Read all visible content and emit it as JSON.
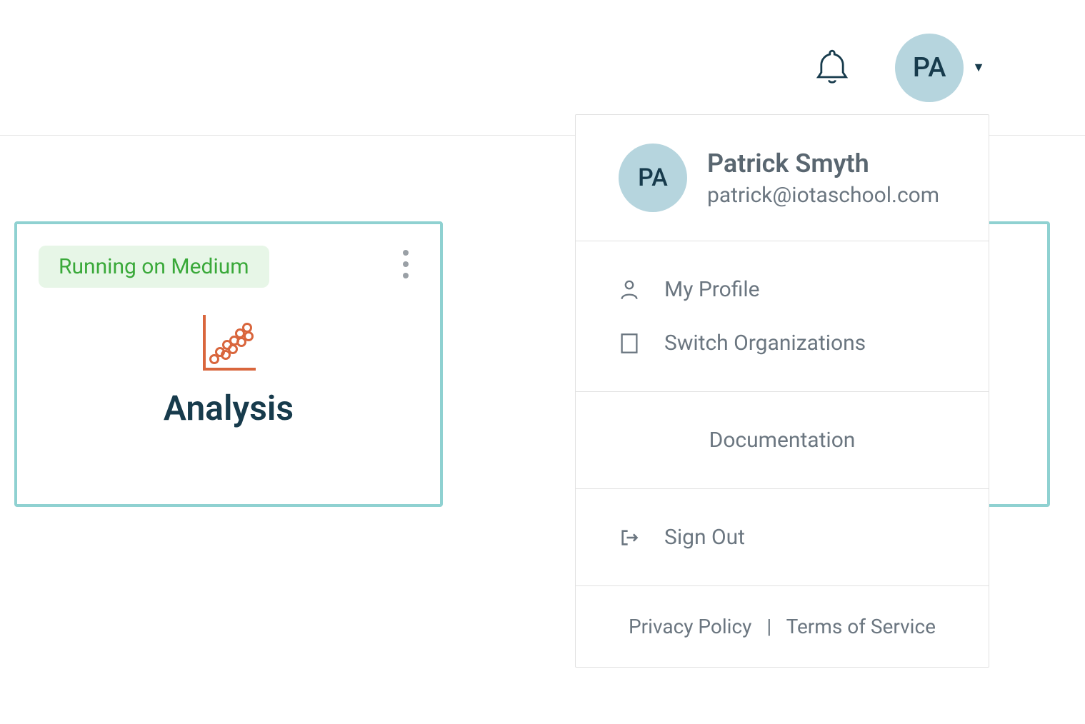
{
  "header": {
    "avatar_initials": "PA"
  },
  "card": {
    "status": "Running on Medium",
    "title": "Analysis"
  },
  "user_menu": {
    "avatar_initials": "PA",
    "name": "Patrick Smyth",
    "email": "patrick@iotaschool.com",
    "items": {
      "profile": "My Profile",
      "switch_org": "Switch Organizations",
      "documentation": "Documentation",
      "sign_out": "Sign Out"
    },
    "footer": {
      "privacy": "Privacy Policy",
      "sep": "|",
      "terms": "Terms of Service"
    }
  }
}
